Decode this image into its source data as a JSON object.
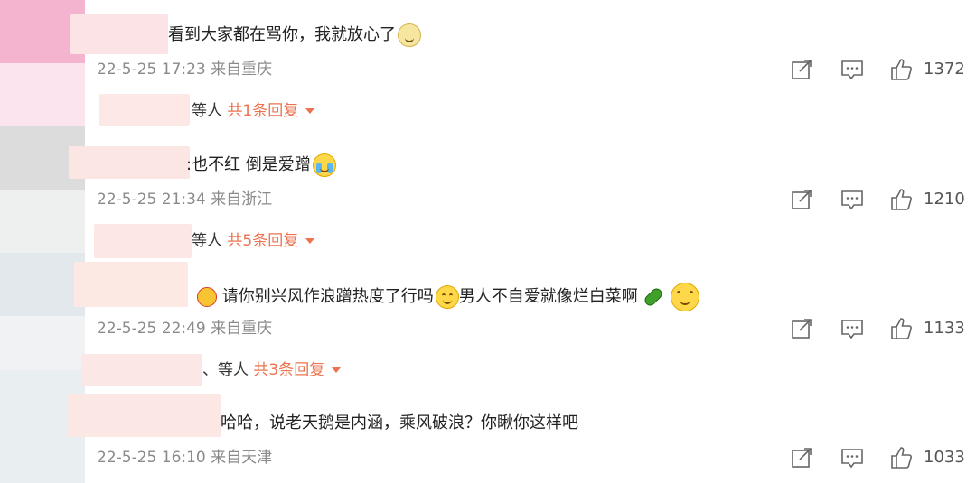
{
  "comments": [
    {
      "text": "看到大家都在骂你，我就放心了",
      "time": "22-5-25 17:23",
      "location": "来自重庆",
      "likes": "1372",
      "reply_who": "等人",
      "reply_count": "共1条回复"
    },
    {
      "text": ":也不红 倒是爱蹭",
      "time": "22-5-25 21:34",
      "location": "来自浙江",
      "likes": "1210",
      "reply_who": "等人",
      "reply_count": "共5条回复"
    },
    {
      "text_a": "请你别兴风作浪蹭热度了行吗",
      "text_b": "男人不自爱就像烂白菜啊",
      "time": "22-5-25 22:49",
      "location": "来自重庆",
      "likes": "1133",
      "reply_who": "、等人",
      "reply_count": "共3条回复"
    },
    {
      "text": "哈哈，说老天鹅是内涵，乘风破浪？你瞅你这样吧",
      "time": "22-5-25 16:10",
      "location": "来自天津",
      "likes": "1033"
    }
  ],
  "icons": {
    "share": "share-icon",
    "comment": "comment-icon",
    "like": "thumbs-up-icon"
  },
  "colors": {
    "reply_accent": "#eb7350",
    "meta_gray": "#8a8a8a"
  }
}
